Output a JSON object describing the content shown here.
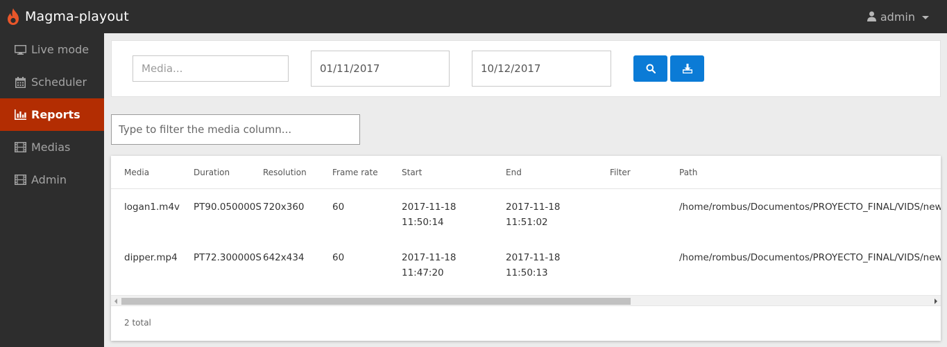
{
  "app": {
    "title": "Magma-playout",
    "brand_color": "#e8562a"
  },
  "user_menu": {
    "label": "admin",
    "icon": "user-icon"
  },
  "sidebar": {
    "active_color": "#b32d02",
    "items": [
      {
        "label": "Live mode",
        "icon": "monitor-icon",
        "active": false
      },
      {
        "label": "Scheduler",
        "icon": "calendar-icon",
        "active": false
      },
      {
        "label": "Reports",
        "icon": "bar-chart-icon",
        "active": true
      },
      {
        "label": "Medias",
        "icon": "film-icon",
        "active": false
      },
      {
        "label": "Admin",
        "icon": "film-icon",
        "active": false
      }
    ]
  },
  "search": {
    "media_placeholder": "Media...",
    "media_value": "",
    "start_date": "01/11/2017",
    "end_date": "10/12/2017",
    "search_icon": "search-icon",
    "download_icon": "download-icon",
    "button_color": "#0b7bd6"
  },
  "filter": {
    "placeholder": "Type to filter the media column...",
    "value": ""
  },
  "table": {
    "columns": [
      "Media",
      "Duration",
      "Resolution",
      "Frame rate",
      "Start",
      "End",
      "Filter",
      "Path"
    ],
    "rows": [
      {
        "media": "logan1.m4v",
        "duration": "PT90.050000S",
        "resolution": "720x360",
        "frame_rate": "60",
        "start_date": "2017-11-18",
        "start_time": "11:50:14",
        "end_date": "2017-11-18",
        "end_time": "11:51:02",
        "filter": "",
        "path": "/home/rombus/Documentos/PROYECTO_FINAL/VIDS/new"
      },
      {
        "media": "dipper.mp4",
        "duration": "PT72.300000S",
        "resolution": "642x434",
        "frame_rate": "60",
        "start_date": "2017-11-18",
        "start_time": "11:47:20",
        "end_date": "2017-11-18",
        "end_time": "11:50:13",
        "filter": "",
        "path": "/home/rombus/Documentos/PROYECTO_FINAL/VIDS/new"
      }
    ],
    "total": "2 total"
  }
}
